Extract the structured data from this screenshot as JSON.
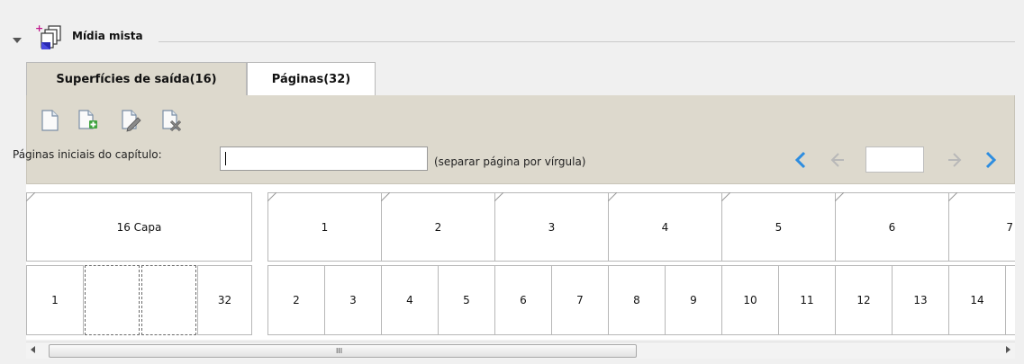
{
  "section": {
    "title": "Mídia mista",
    "icon": "mixed-media-icon"
  },
  "tabs": [
    {
      "label": "Superfícies de saída(16)",
      "active": true
    },
    {
      "label": "Páginas(32)",
      "active": false
    }
  ],
  "toolbar": {
    "icons": [
      "new-page-icon",
      "add-page-icon",
      "edit-page-icon",
      "delete-page-icon"
    ],
    "chapter_label": "Páginas iniciais do capítulo:",
    "chapter_value": "",
    "chapter_hint": "(separar página por vírgula)",
    "page_value": ""
  },
  "surfaces": [
    {
      "label": "16 Capa"
    },
    {
      "label": "1"
    },
    {
      "label": "2"
    },
    {
      "label": "3"
    },
    {
      "label": "4"
    },
    {
      "label": "5"
    },
    {
      "label": "6"
    },
    {
      "label": "7"
    }
  ],
  "pages": {
    "cover": [
      "1",
      "",
      "",
      "32"
    ],
    "row": [
      "2",
      "3",
      "4",
      "5",
      "6",
      "7",
      "8",
      "9",
      "10",
      "11",
      "12",
      "13",
      "14"
    ]
  },
  "scrollbar": {
    "grip": "III"
  },
  "colors": {
    "panel": "#ddd9cd",
    "nav_active": "#2d8de0",
    "nav_disabled": "#b8b8b8"
  }
}
